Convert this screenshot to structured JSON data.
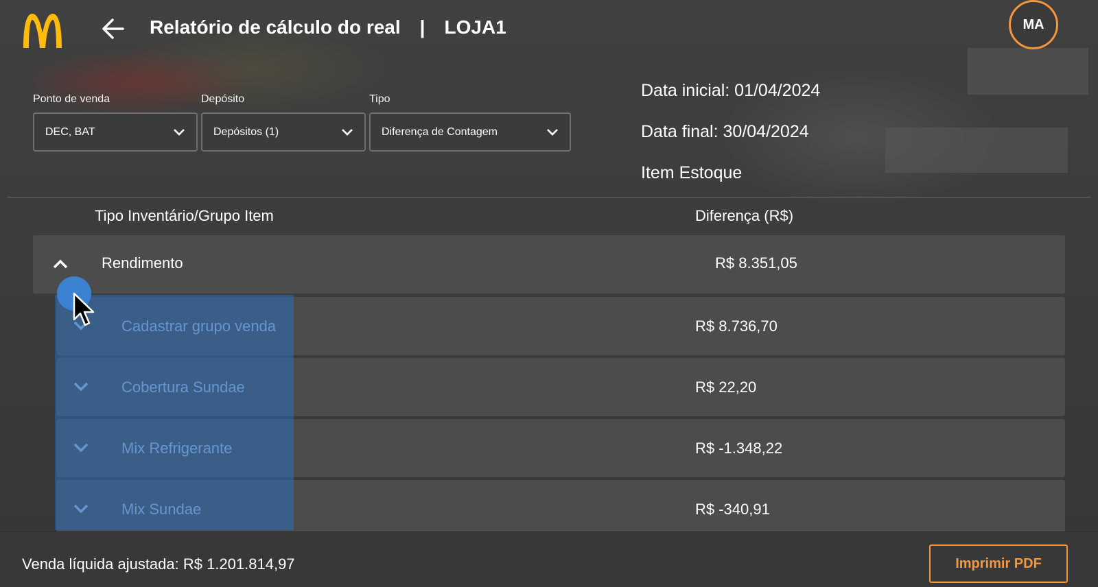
{
  "header": {
    "title": "Relatório de cálculo do real",
    "separator": "|",
    "store": "LOJA1",
    "avatar_initials": "MA"
  },
  "colors": {
    "accent_orange": "#f4973c",
    "logo_yellow": "#ffbc0d",
    "selection_blue": "#2c6eb9"
  },
  "icons": {
    "logo": "golden-arches-logo",
    "back": "arrow-left-icon",
    "dropdown": "chevron-down-icon",
    "expanded": "chevron-up-icon",
    "collapsed": "chevron-down-icon",
    "cursor": "mouse-pointer-icon"
  },
  "filters": {
    "ponto_venda": {
      "label": "Ponto de venda",
      "value": "DEC, BAT"
    },
    "deposito": {
      "label": "Depósito",
      "value": "Depósitos (1)"
    },
    "tipo": {
      "label": "Tipo",
      "value": "Diferença de Contagem"
    }
  },
  "info": {
    "data_inicial": "Data inicial: 01/04/2024",
    "data_final": "Data final: 30/04/2024",
    "item": "Item Estoque"
  },
  "table": {
    "columns": [
      "Tipo Inventário/Grupo Item",
      "Diferença (R$)"
    ],
    "group": {
      "name": "Rendimento",
      "value": "R$ 8.351,05"
    },
    "rows": [
      {
        "name": "Cadastrar grupo venda",
        "value": "R$ 8.736,70"
      },
      {
        "name": "Cobertura Sundae",
        "value": "R$ 22,20"
      },
      {
        "name": "Mix Refrigerante",
        "value": "R$ -1.348,22"
      },
      {
        "name": "Mix Sundae",
        "value": "R$ -340,91"
      }
    ]
  },
  "footer": {
    "net_sales": "Venda líquida ajustada: R$ 1.201.814,97",
    "print_button": "Imprimir PDF"
  }
}
